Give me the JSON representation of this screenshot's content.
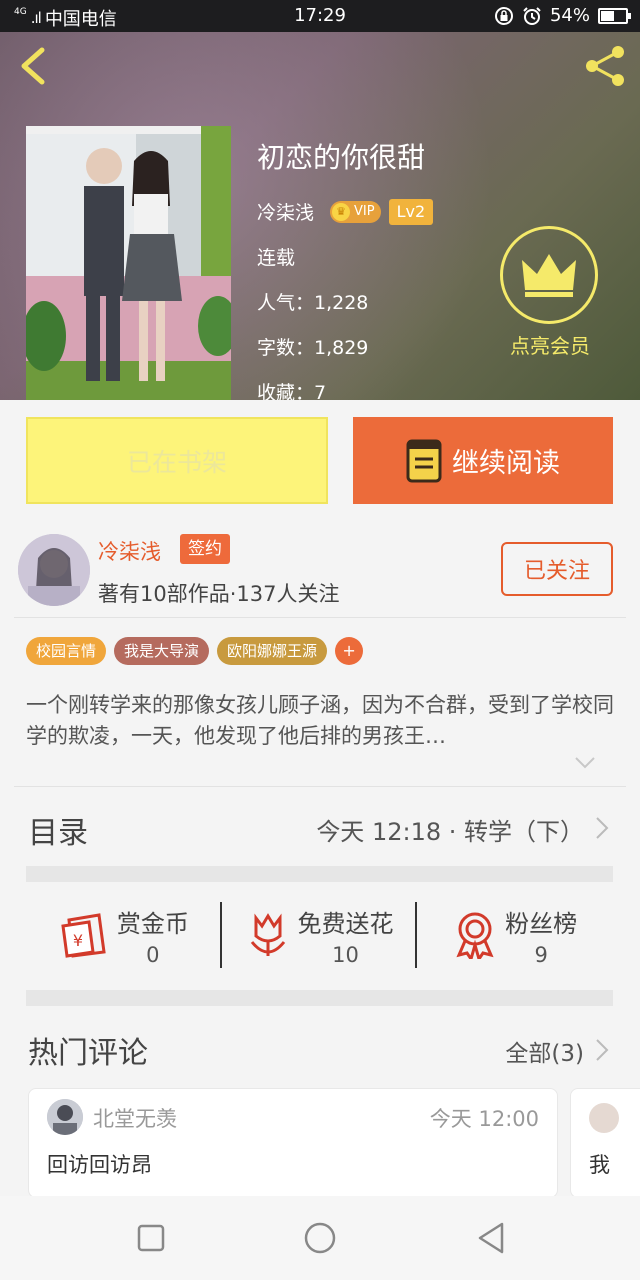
{
  "status_bar": {
    "signal_type": "4G",
    "signal_bars": "•❘l",
    "carrier": "中国电信",
    "time": "17:29",
    "battery": "54%",
    "battery_level": 0.54
  },
  "book": {
    "title": "初恋的你很甜",
    "author": "冷柒浅",
    "vip_label": "VIP",
    "level": "Lv2",
    "status": "连载",
    "popularity": "人气：1,228",
    "word_count": "字数：1,829",
    "favorites": "收藏：7",
    "member_label": "点亮会员"
  },
  "actions": {
    "shelf_label": "已在书架",
    "read_label": "继续阅读"
  },
  "author_card": {
    "name": "冷柒浅",
    "sign_badge": "签约",
    "stats": "著有10部作品·137人关注",
    "follow_label": "已关注"
  },
  "tags": [
    {
      "label": "校园言情",
      "color": "#f0a63b"
    },
    {
      "label": "我是大导演",
      "color": "#b56b5e"
    },
    {
      "label": "欧阳娜娜王源",
      "color": "#c89a3e"
    }
  ],
  "tag_add": "+",
  "synopsis": "一个刚转学来的那像女孩儿顾子涵，因为不合群，受到了学校同学的欺凌，一天，他发现了他后排的男孩王…",
  "toc": {
    "label": "目录",
    "latest": "今天 12:18 · 转学（下）"
  },
  "stats": [
    {
      "name": "赏金币",
      "value": "0",
      "icon": "red-envelope-icon"
    },
    {
      "name": "免费送花",
      "value": "10",
      "icon": "flower-icon"
    },
    {
      "name": "粉丝榜",
      "value": "9",
      "icon": "ribbon-medal-icon"
    }
  ],
  "comments": {
    "title": "热门评论",
    "all_label": "全部(3)",
    "items": [
      {
        "user": "北堂无羡",
        "time": "今天 12:00",
        "body": "回访回访昂"
      },
      {
        "user": "",
        "time": "",
        "body": "我"
      }
    ]
  },
  "colors": {
    "accent": "#ec6b3a",
    "shelf": "#fdf47a",
    "member": "#f5ea6a"
  }
}
